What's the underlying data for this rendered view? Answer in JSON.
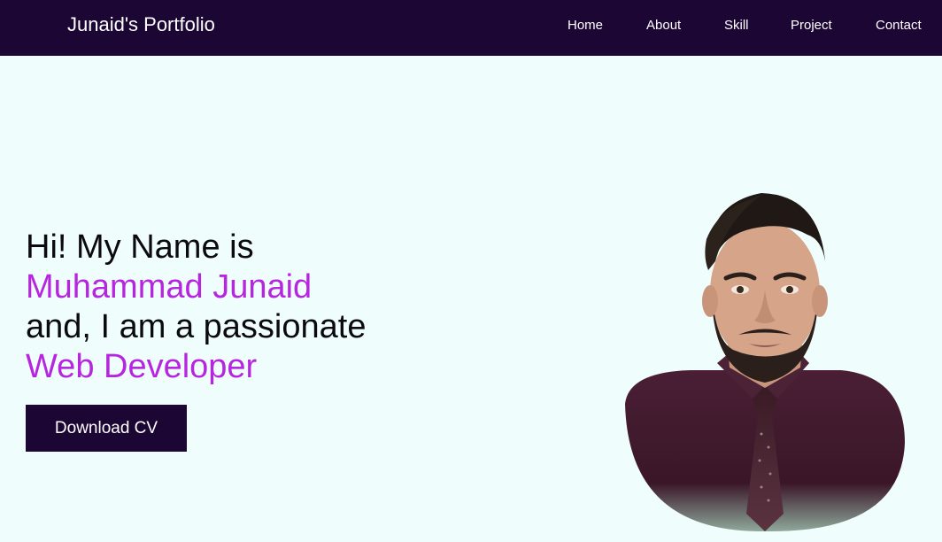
{
  "navbar": {
    "brand": "Junaid's Portfolio",
    "links": [
      "Home",
      "About",
      "Skill",
      "Project",
      "Contact"
    ]
  },
  "hero": {
    "line1": "Hi! My Name is",
    "name": "Muhammad Junaid",
    "line3": "and, I am a passionate",
    "role": "Web Developer",
    "cv_button": "Download CV"
  },
  "colors": {
    "navbar_bg": "#1c0634",
    "page_bg": "#effefd",
    "accent": "#b626de",
    "button_bg": "#1c0634"
  },
  "portrait": {
    "icon": "profile-photo"
  }
}
